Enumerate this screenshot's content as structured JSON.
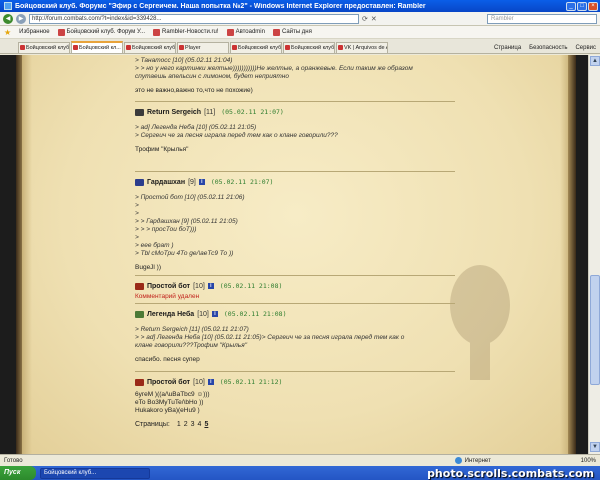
{
  "window": {
    "title": "Бойцовский клуб. Форумс \"Эфир с Сергеичем. Наша попытка №2\" - Windows Internet Explorer предоставлен: Rambler"
  },
  "address": {
    "url": "http://forum.combats.com/?t=index&id=339428...",
    "search_placeholder": "Rambler"
  },
  "favorites": {
    "label": "Избранное",
    "items": [
      "Бойцовский клуб. Форум У...",
      "Rambler-Новости.ru!",
      "Автоadmin",
      "Сайты дня"
    ]
  },
  "tabs": [
    "Бойцовский клуб",
    "Бойцовский кл...",
    "Бойцовский клуб",
    "Player",
    "Бойцовский клуб",
    "Бойцовский клуб",
    "VK | Arquivos de A..."
  ],
  "page_tools": [
    "Страница",
    "Безопасность",
    "Сервис"
  ],
  "thread": {
    "top_quotes": [
      "> Танатосс [10] (05.02.11 21:04)",
      "> > но у него картинки желтые)))))))))))Не желтые, а оранжевые. Если таким же образом",
      "спутаешь апельсин с лимоном, будет неприятно"
    ],
    "top_text": "это не важно,важно то,что не похожие)",
    "posts": [
      {
        "name": "Return Sergeich",
        "level": "[11]",
        "date": "(05.02.11 21:07)",
        "quotes": [
          "> ad] Легенда Неба [10] (05.02.11 21:05)",
          "> Сергеич че за песня играла перед тем как о клане говорили???"
        ],
        "text": "Трофим \"Крылья\""
      },
      {
        "name": "Гардашхан",
        "level": "[9]",
        "date": "(05.02.11 21:07)",
        "quotes": [
          "> Простой бот [10] (05.02.11 21:06)",
          ">",
          ">",
          "> > Гардашхан [9] (05.02.11 21:05)",
          "> > > просТоu боТ)))",
          ">",
          "> еее брат )",
          "> Тbl сМоТри 4То ge/\\аеТс9 То ))"
        ],
        "text": "BugeJl ))"
      },
      {
        "name": "Простой бот",
        "level": "[10]",
        "date": "(05.02.11 21:08)",
        "deleted": "Комментарий удален"
      },
      {
        "name": "Легенда Неба",
        "level": "[10]",
        "date": "(05.02.11 21:08)",
        "quotes": [
          ">  Return Sergeich [11] (05.02.11 21:07)",
          "> > ad] Легенда Неба [10] (05.02.11 21:05)> Сергеич че за песня играла перед тем как о",
          "клане говорили???Трофим \"Крылья\""
        ],
        "text": "спасибо. песня супер"
      },
      {
        "name": "Простой бот",
        "level": "[10]",
        "date": "(05.02.11 21:12)",
        "lines": [
          "6угеМ )((а/\\uBaTbc9 ☺)))",
          "eTo Bo3MyTuTe/\\bHo ))",
          "Hukakoro yBa)(eHu9 )"
        ]
      }
    ],
    "pager": {
      "label": "Страницы:",
      "pages": [
        "1",
        "2",
        "3",
        "4"
      ],
      "current": "5"
    }
  },
  "status": {
    "left": "Готово",
    "zone": "Интернет",
    "zoom": "100%"
  },
  "taskbar": {
    "start": "Пуск",
    "task": "Бойцовский клуб...",
    "watermark": "photo.scrolls.combats.com"
  }
}
